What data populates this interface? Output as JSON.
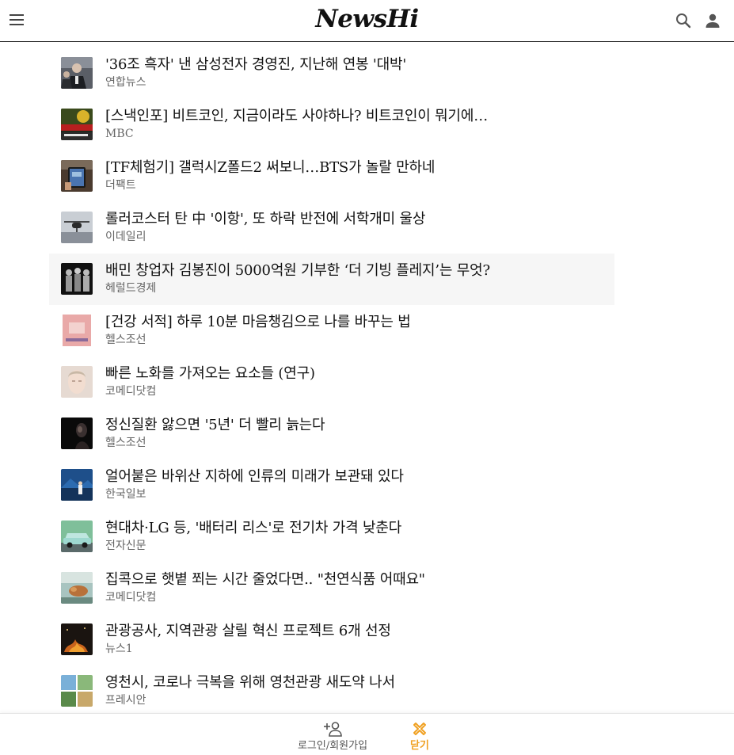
{
  "header": {
    "logo": "NewsHi",
    "menu_icon": "hamburger-menu-icon",
    "search_icon": "search-icon",
    "user_icon": "user-icon"
  },
  "news": [
    {
      "title": "'36조 흑자' 낸 삼성전자 경영진, 지난해 연봉 '대박'",
      "source": "연합뉴스"
    },
    {
      "title": "[스낵인포] 비트코인, 지금이라도 사야하나? 비트코인이 뭐기에…",
      "source": "MBC"
    },
    {
      "title": "[TF체험기] 갤럭시Z폴드2 써보니…BTS가 놀랄 만하네",
      "source": "더팩트"
    },
    {
      "title": "롤러코스터 탄 中 '이항', 또 하락 반전에 서학개미 울상",
      "source": "이데일리"
    },
    {
      "title": "배민 창업자 김봉진이 5000억원 기부한 ‘더 기빙 플레지’는 무엇?",
      "source": "헤럴드경제"
    },
    {
      "title": "[건강 서적] 하루 10분 마음챙김으로 나를 바꾸는 법",
      "source": "헬스조선"
    },
    {
      "title": "빠른 노화를 가져오는 요소들 (연구)",
      "source": "코메디닷컴"
    },
    {
      "title": "정신질환 앓으면 '5년' 더 빨리 늙는다",
      "source": "헬스조선"
    },
    {
      "title": "얼어붙은 바위산 지하에 인류의 미래가 보관돼 있다",
      "source": "한국일보"
    },
    {
      "title": "현대차·LG 등, '배터리 리스'로 전기차 가격 낮춘다",
      "source": "전자신문"
    },
    {
      "title": "집콕으로 햇볕 쬐는 시간 줄었다면.. \"천연식품 어때요\"",
      "source": "코메디닷컴"
    },
    {
      "title": "관광공사, 지역관광 살릴 혁신 프로젝트 6개 선정",
      "source": "뉴스1"
    },
    {
      "title": "영천시, 코로나 극복을 위해 영천관광 새도약 나서",
      "source": "프레시안"
    }
  ],
  "bottom_bar": {
    "login_label": "로그인/회원가입",
    "login_icon": "add-user-icon",
    "close_label": "닫기",
    "close_icon": "close-x-icon",
    "accent_color": "#f0a020"
  }
}
